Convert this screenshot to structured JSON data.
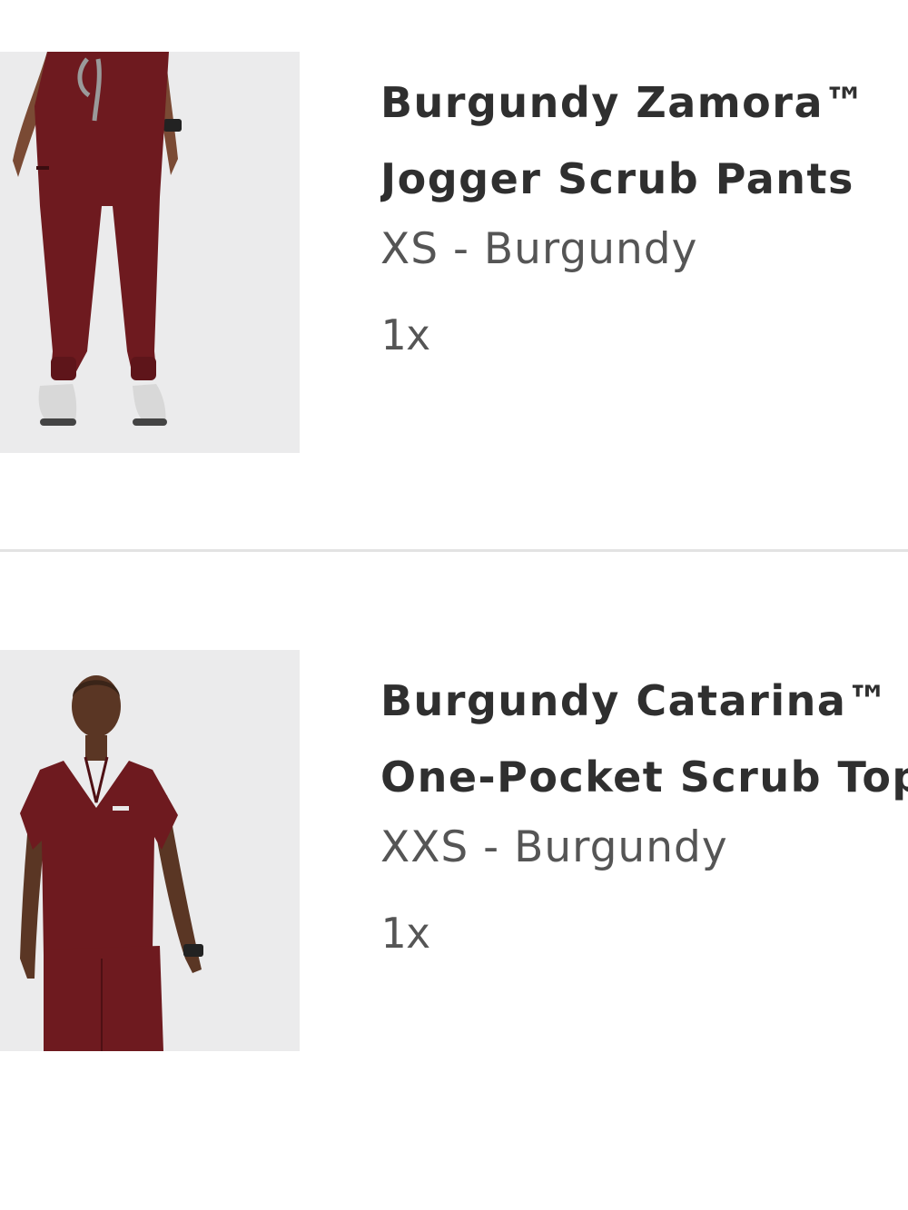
{
  "cart": {
    "items": [
      {
        "name_line1": "Burgundy Zamora™",
        "name_line2": "Jogger Scrub Pants",
        "variant": "XS - Burgundy",
        "quantity": "1x",
        "image_icon": "burgundy-jogger-pants-photo"
      },
      {
        "name_line1": "Burgundy Catarina™",
        "name_line2": "One-Pocket Scrub Top",
        "variant": "XXS - Burgundy",
        "quantity": "1x",
        "image_icon": "burgundy-scrub-top-photo"
      }
    ]
  },
  "colors": {
    "product": "#6e1a1f",
    "background": "#ffffff",
    "thumb_bg": "#ebebec",
    "divider": "#e3e3e3"
  }
}
